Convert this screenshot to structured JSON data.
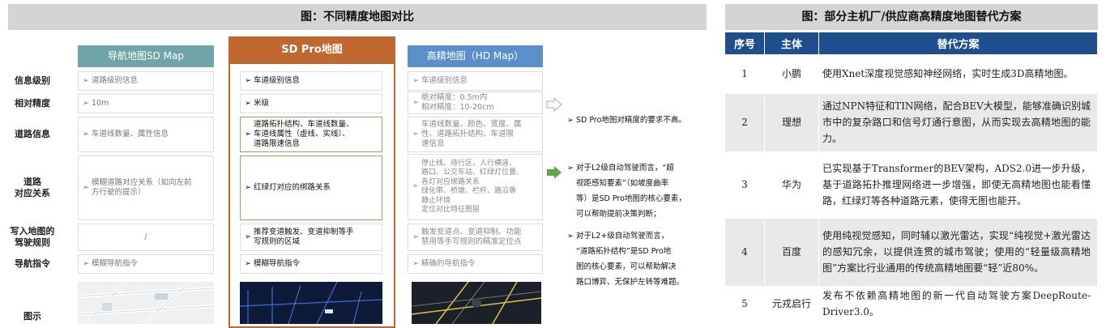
{
  "left": {
    "title": "图：不同精度地图对比",
    "columns": [
      "导航地图SD Map",
      "SD Pro地图",
      "高精地图（HD Map）"
    ],
    "rows": [
      {
        "label": "信息级别",
        "sd": "道路级别信息",
        "pro": "车道级别信息",
        "hd": "车道级别信息"
      },
      {
        "label": "相对精度",
        "sd": "10m",
        "pro": "米级",
        "hd": "绝对精度：0.5m内\n相对精度：10-20cm"
      },
      {
        "label": "道路信息",
        "sd": "车道线数量、属性信息",
        "pro": "道路拓扑结构、车道线数量、\n车道线属性（虚线、实线）、\n道路限速信息",
        "hd": "车道线数量、颜色、宽度、属\n性、道路拓扑结构、车道限\n速信息"
      },
      {
        "label": "道路\n对应关系",
        "sd": "模糊道路对应关系（如向左前\n方行驶的提示）",
        "pro": "红绿灯对应的绑路关系",
        "hd": "停止线、待行区、人行横道、\n路口、公交车站、红绿灯位置、\n各灯对应绑路关系\n绿化带、桥墩、栏杆、路沿等\n静止环境\n定位对比特征图层"
      },
      {
        "label": "写入地图的\n驾驶规则",
        "sd": "/",
        "pro": "推荐变道触发、变道抑制等手\n写规则的区域",
        "hd": "触发变道点、变道抑制、功能\n禁用等手写规则的精准定位点"
      },
      {
        "label": "导航指令",
        "sd": "模糊导航指令",
        "pro": "模糊导航指令",
        "hd": "精确的导航指令"
      },
      {
        "label": "图示",
        "sd": "",
        "pro": "",
        "hd": ""
      }
    ],
    "notes": [
      "SD Pro地图对精度的要求不高。",
      "对于L2级自动驾驶而言，“超\n视距感知要素”（如坡度曲率\n等）是SD Pro地图的核心要素，\n可以帮助提前决策判断；",
      "对于L2+级自动驾驶而言，\n“道路拓扑结构”是SD Pro地\n图的核心要素，可以帮助解决\n路口博弈、无保护左转等难题。"
    ]
  },
  "right": {
    "title": "图：部分主机厂/供应商高精度地图替代方案",
    "headers": [
      "序号",
      "主体",
      "替代方案"
    ],
    "rows": [
      {
        "no": "1",
        "subject": "小鹏",
        "plan": "使用Xnet深度视觉感知神经网络，实时生成3D高精地图。"
      },
      {
        "no": "2",
        "subject": "理想",
        "plan": "通过NPN特征和TIN网络，配合BEV大模型，能够准确识别城市中的复杂路口和信号灯通行意图，从而实现去高精地图的能力。"
      },
      {
        "no": "3",
        "subject": "华为",
        "plan": "已实现基于Transformer的BEV架构，ADS2.0进一步升级，基于道路拓扑推理网络进一步增强，即使无高精地图也能看懂路，红绿灯等各种道路元素，使得无图也能开。"
      },
      {
        "no": "4",
        "subject": "百度",
        "plan": "使用纯视觉感知，同时辅以激光雷达，实现“纯视觉+激光雷达的感知冗余，以提供连贯的城市驾驶；使用的“轻量级高精地图”方案比行业通用的传统高精地图要“轻”近80%。"
      },
      {
        "no": "5",
        "subject": "元戎启行",
        "plan": "发布不依赖高精地图的新一代自动驾驶方案DeepRoute-Driver3.0。"
      }
    ]
  },
  "colors": {
    "sd_header": "#6fa5a8",
    "pro_accent": "#c0682f",
    "hd_header": "#5b8fc9",
    "table_header": "#1e4e8c",
    "arrow_green": "#5fa84a"
  },
  "icons": [
    "bullet-arrow-icon",
    "hollow-arrow-icon",
    "green-arrow-icon"
  ]
}
